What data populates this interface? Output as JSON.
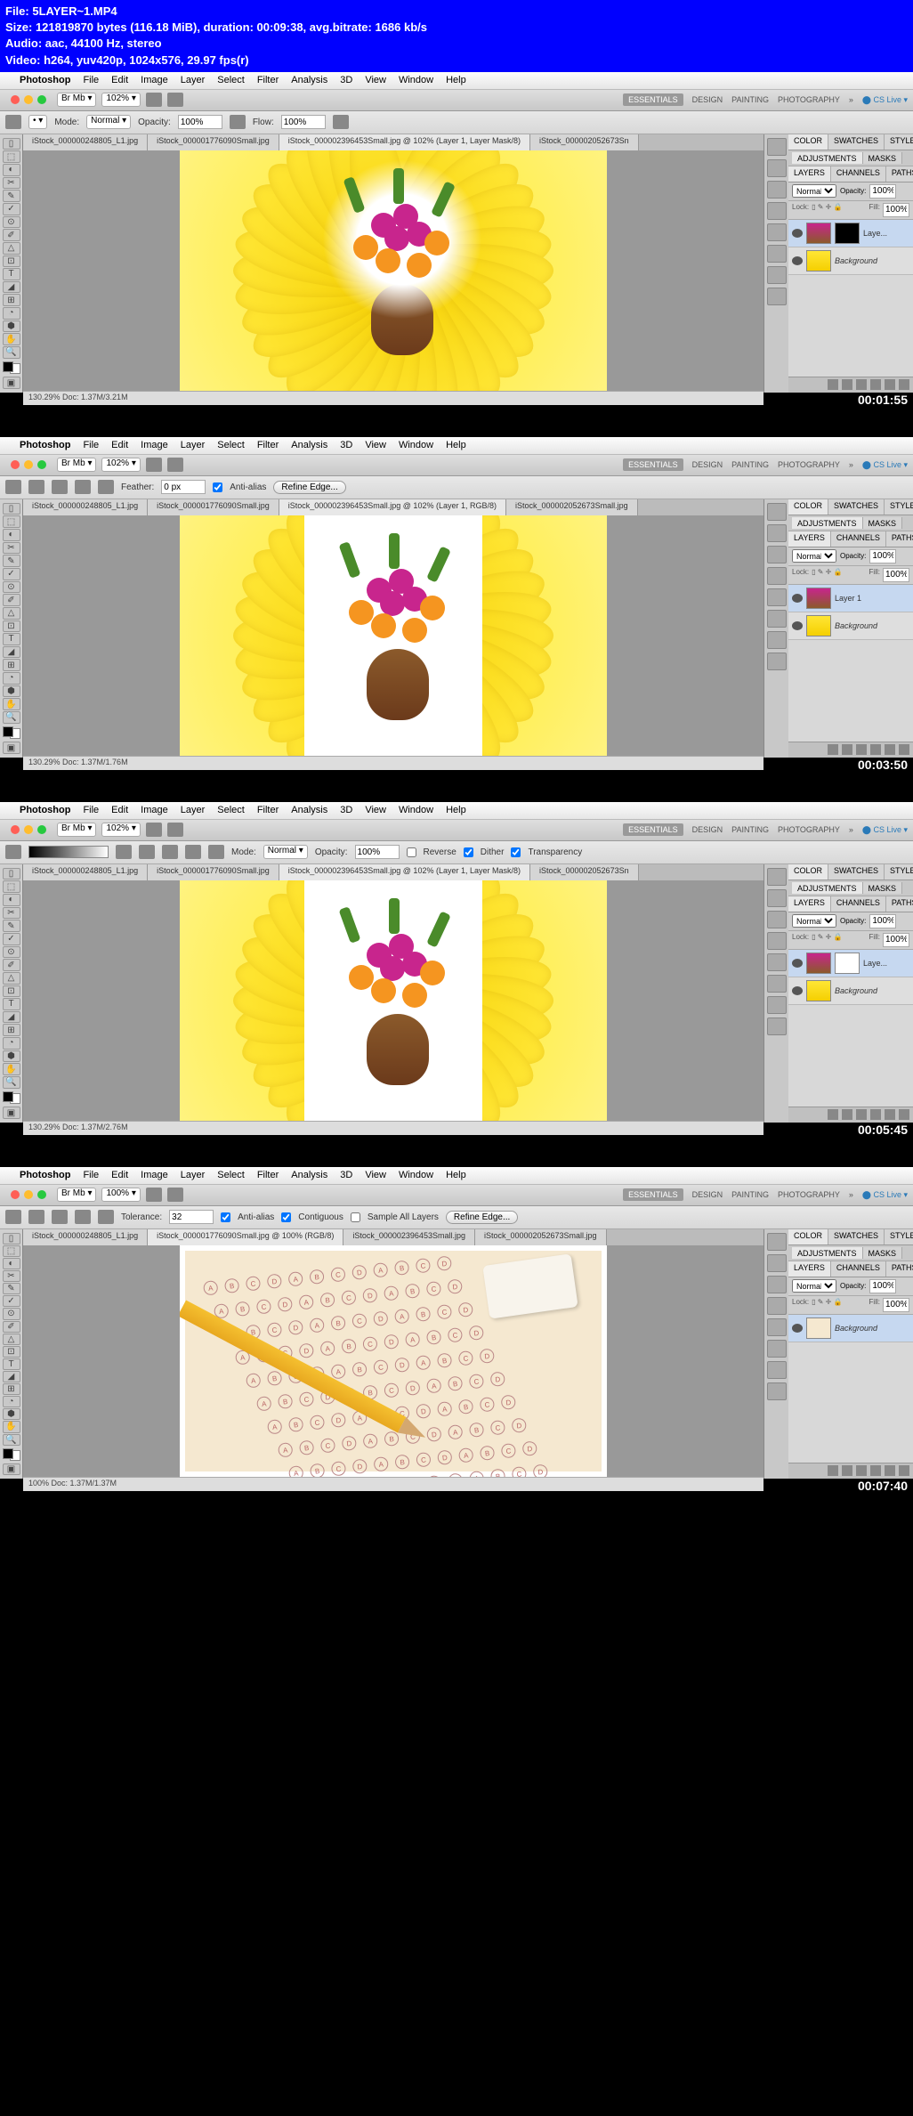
{
  "header": {
    "line1_label": "File:",
    "line1_value": "5LAYER~1.MP4",
    "line2": "Size: 121819870 bytes (116.18 MiB), duration: 00:09:38, avg.bitrate: 1686 kb/s",
    "line3": "Audio: aac, 44100 Hz, stereo",
    "line4": "Video: h264, yuv420p, 1024x576, 29.97 fps(r)"
  },
  "menubar": {
    "app": "Photoshop",
    "items": [
      "File",
      "Edit",
      "Image",
      "Layer",
      "Select",
      "Filter",
      "Analysis",
      "3D",
      "View",
      "Window",
      "Help"
    ]
  },
  "workspace_tabs": {
    "active": "ESSENTIALS",
    "items": [
      "DESIGN",
      "PAINTING",
      "PHOTOGRAPHY"
    ],
    "cslive": "CS Live"
  },
  "toolbar": {
    "zoom": "102%"
  },
  "frames": [
    {
      "timestamp": "00:01:55",
      "options": {
        "mode_label": "Mode:",
        "mode_value": "Normal",
        "opacity_label": "Opacity:",
        "opacity_value": "100%",
        "flow_label": "Flow:",
        "flow_value": "100%"
      },
      "doc_tabs": [
        "iStock_000000248805_L1.jpg",
        "iStock_000001776090Small.jpg",
        "iStock_000002396453Small.jpg @ 102% (Layer 1, Layer Mask/8)",
        "iStock_000002052673Sn"
      ],
      "status": "130.29%    Doc: 1.37M/3.21M",
      "layers": [
        {
          "name": "Laye...",
          "sel": true,
          "mask": "black",
          "thumb": "bouquet"
        },
        {
          "name": "Background",
          "italic": true,
          "thumb": "flower"
        }
      ]
    },
    {
      "timestamp": "00:03:50",
      "options": {
        "feather_label": "Feather:",
        "feather_value": "0 px",
        "aa_label": "Anti-alias",
        "refine": "Refine Edge..."
      },
      "doc_tabs": [
        "iStock_000000248805_L1.jpg",
        "iStock_000001776090Small.jpg",
        "iStock_000002396453Small.jpg @ 102% (Layer 1, RGB/8)",
        "iStock_000002052673Small.jpg"
      ],
      "status": "130.29%    Doc: 1.37M/1.76M",
      "layers": [
        {
          "name": "Layer 1",
          "sel": true,
          "thumb": "bouquet"
        },
        {
          "name": "Background",
          "italic": true,
          "thumb": "flower"
        }
      ]
    },
    {
      "timestamp": "00:05:45",
      "options": {
        "mode_label": "Mode:",
        "mode_value": "Normal",
        "opacity_label": "Opacity:",
        "opacity_value": "100%",
        "reverse": "Reverse",
        "dither": "Dither",
        "trans": "Transparency"
      },
      "doc_tabs": [
        "iStock_000000248805_L1.jpg",
        "iStock_000001776090Small.jpg",
        "iStock_000002396453Small.jpg @ 102% (Layer 1, Layer Mask/8)",
        "iStock_000002052673Sn"
      ],
      "status": "130.29%    Doc: 1.37M/2.76M",
      "layers": [
        {
          "name": "Laye...",
          "sel": true,
          "mask": "white",
          "thumb": "bouquet"
        },
        {
          "name": "Background",
          "italic": true,
          "thumb": "flower"
        }
      ]
    },
    {
      "timestamp": "00:07:40",
      "options": {
        "tol_label": "Tolerance:",
        "tol_value": "32",
        "aa_label": "Anti-alias",
        "cont_label": "Contiguous",
        "sample_label": "Sample All Layers",
        "refine": "Refine Edge..."
      },
      "doc_tabs": [
        "iStock_000000248805_L1.jpg",
        "iStock_000001776090Small.jpg @ 100% (RGB/8)",
        "iStock_000002396453Small.jpg",
        "iStock_000002052673Small.jpg"
      ],
      "status": "100%    Doc: 1.37M/1.37M",
      "toolbar_zoom": "100%",
      "layers": [
        {
          "name": "Background",
          "italic": true,
          "sel": true,
          "thumb": "scan"
        }
      ]
    }
  ],
  "panels": {
    "color_tabs": [
      "COLOR",
      "SWATCHES",
      "STYLES"
    ],
    "adj_tabs": [
      "ADJUSTMENTS",
      "MASKS"
    ],
    "layer_tabs": [
      "LAYERS",
      "CHANNELS",
      "PATHS"
    ],
    "blend": "Normal",
    "opacity_label": "Opacity:",
    "opacity_value": "100%",
    "lock_label": "Lock:",
    "fill_label": "Fill:",
    "fill_value": "100%"
  }
}
